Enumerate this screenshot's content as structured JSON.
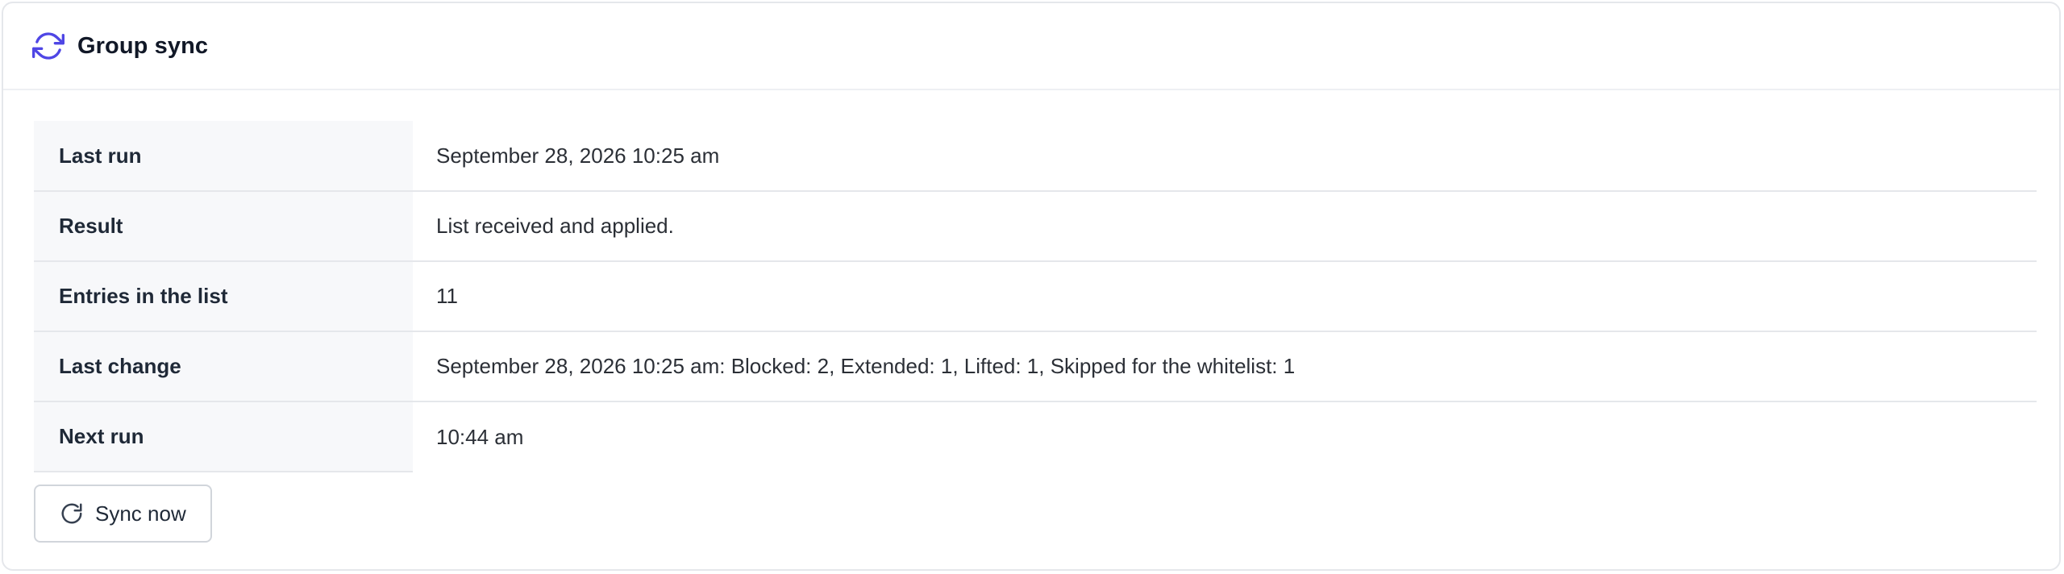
{
  "panel": {
    "title": "Group sync",
    "title_icon": "sync-icon",
    "accent_color": "#4f46e5"
  },
  "details": {
    "rows": [
      {
        "label": "Last run",
        "value": "September 28, 2026 10:25 am"
      },
      {
        "label": "Result",
        "value": "List received and applied."
      },
      {
        "label": "Entries in the list",
        "value": "11"
      },
      {
        "label": "Last change",
        "value": "September 28, 2026 10:25 am: Blocked: 2, Extended: 1, Lifted: 1, Skipped for the whitelist: 1"
      },
      {
        "label": "Next run",
        "value": "10:44 am"
      }
    ]
  },
  "actions": {
    "sync_now_label": "Sync now",
    "sync_now_icon": "refresh-icon"
  }
}
